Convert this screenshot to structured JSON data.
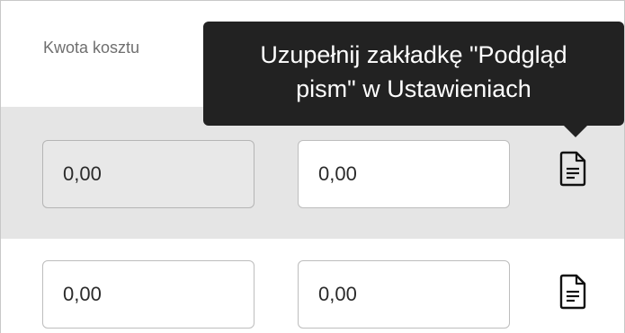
{
  "table": {
    "column_header": "Kwota kosztu",
    "rows": [
      {
        "amount_value": "0,00",
        "amount_readonly": true,
        "second_value": "0,00",
        "icon": "document-icon"
      },
      {
        "amount_value": "0,00",
        "amount_readonly": false,
        "second_value": "0,00",
        "icon": "document-icon"
      }
    ]
  },
  "tooltip": {
    "line1": "Uzupełnij zakładkę \"Podgląd",
    "line2": "pism\" w Ustawieniach"
  }
}
